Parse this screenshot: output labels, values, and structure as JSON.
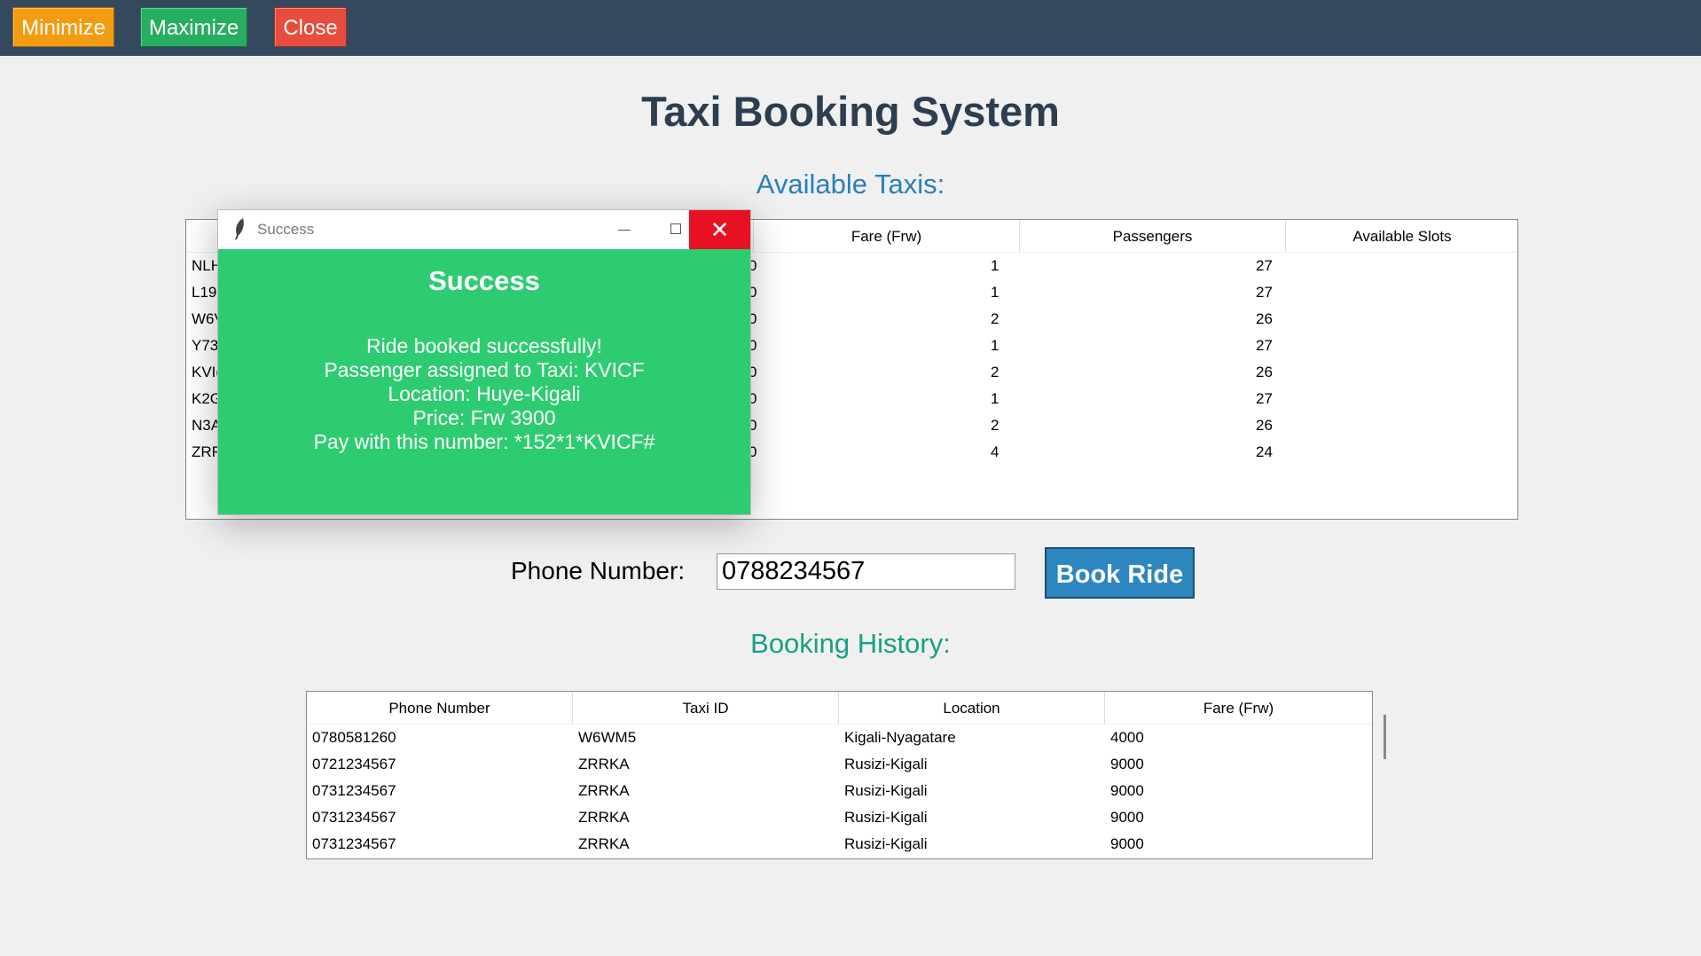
{
  "window": {
    "minimize_label": "Minimize",
    "maximize_label": "Maximize",
    "close_label": "Close",
    "colors": {
      "topbar": "#34495e",
      "minimize": "#f39c12",
      "maximize": "#27ae60",
      "close": "#e74c3c"
    }
  },
  "main": {
    "title": "Taxi Booking System",
    "available_heading": "Available Taxis:",
    "history_heading": "Booking History:",
    "phone_label": "Phone Number:",
    "phone_value": "0788234567",
    "book_button": "Book Ride"
  },
  "taxis_table": {
    "columns": [
      "Fare (Frw)",
      "Passengers",
      "Available Slots"
    ],
    "rows": [
      {
        "id_partial": "NLH",
        "fare_partial": "0",
        "passengers": "1",
        "slots": "27"
      },
      {
        "id_partial": "L19I",
        "fare_partial": "0",
        "passengers": "1",
        "slots": "27"
      },
      {
        "id_partial": "W6V",
        "fare_partial": "0",
        "passengers": "2",
        "slots": "26"
      },
      {
        "id_partial": "Y73",
        "fare_partial": "0",
        "passengers": "1",
        "slots": "27"
      },
      {
        "id_partial": "KVI(",
        "fare_partial": "0",
        "passengers": "2",
        "slots": "26"
      },
      {
        "id_partial": "K2G",
        "fare_partial": "0",
        "passengers": "1",
        "slots": "27"
      },
      {
        "id_partial": "N3A",
        "fare_partial": "0",
        "passengers": "2",
        "slots": "26"
      },
      {
        "id_partial": "ZRR",
        "fare_partial": "0",
        "passengers": "4",
        "slots": "24"
      }
    ]
  },
  "history_table": {
    "columns": [
      "Phone Number",
      "Taxi ID",
      "Location",
      "Fare (Frw)"
    ],
    "rows": [
      {
        "phone": "0780581260",
        "taxi": "W6WM5",
        "location": "Kigali-Nyagatare",
        "fare": "4000"
      },
      {
        "phone": "0721234567",
        "taxi": "ZRRKA",
        "location": "Rusizi-Kigali",
        "fare": "9000"
      },
      {
        "phone": "0731234567",
        "taxi": "ZRRKA",
        "location": "Rusizi-Kigali",
        "fare": "9000"
      },
      {
        "phone": "0731234567",
        "taxi": "ZRRKA",
        "location": "Rusizi-Kigali",
        "fare": "9000"
      },
      {
        "phone": "0731234567",
        "taxi": "ZRRKA",
        "location": "Rusizi-Kigali",
        "fare": "9000"
      }
    ]
  },
  "dialog": {
    "window_title": "Success",
    "heading": "Success",
    "lines": [
      "Ride booked successfully!",
      "Passenger assigned to Taxi: KVICF",
      "Location: Huye-Kigali",
      "Price: Frw 3900",
      "Pay with this number: *152*1*KVICF#"
    ],
    "background": "#2ecc71"
  }
}
